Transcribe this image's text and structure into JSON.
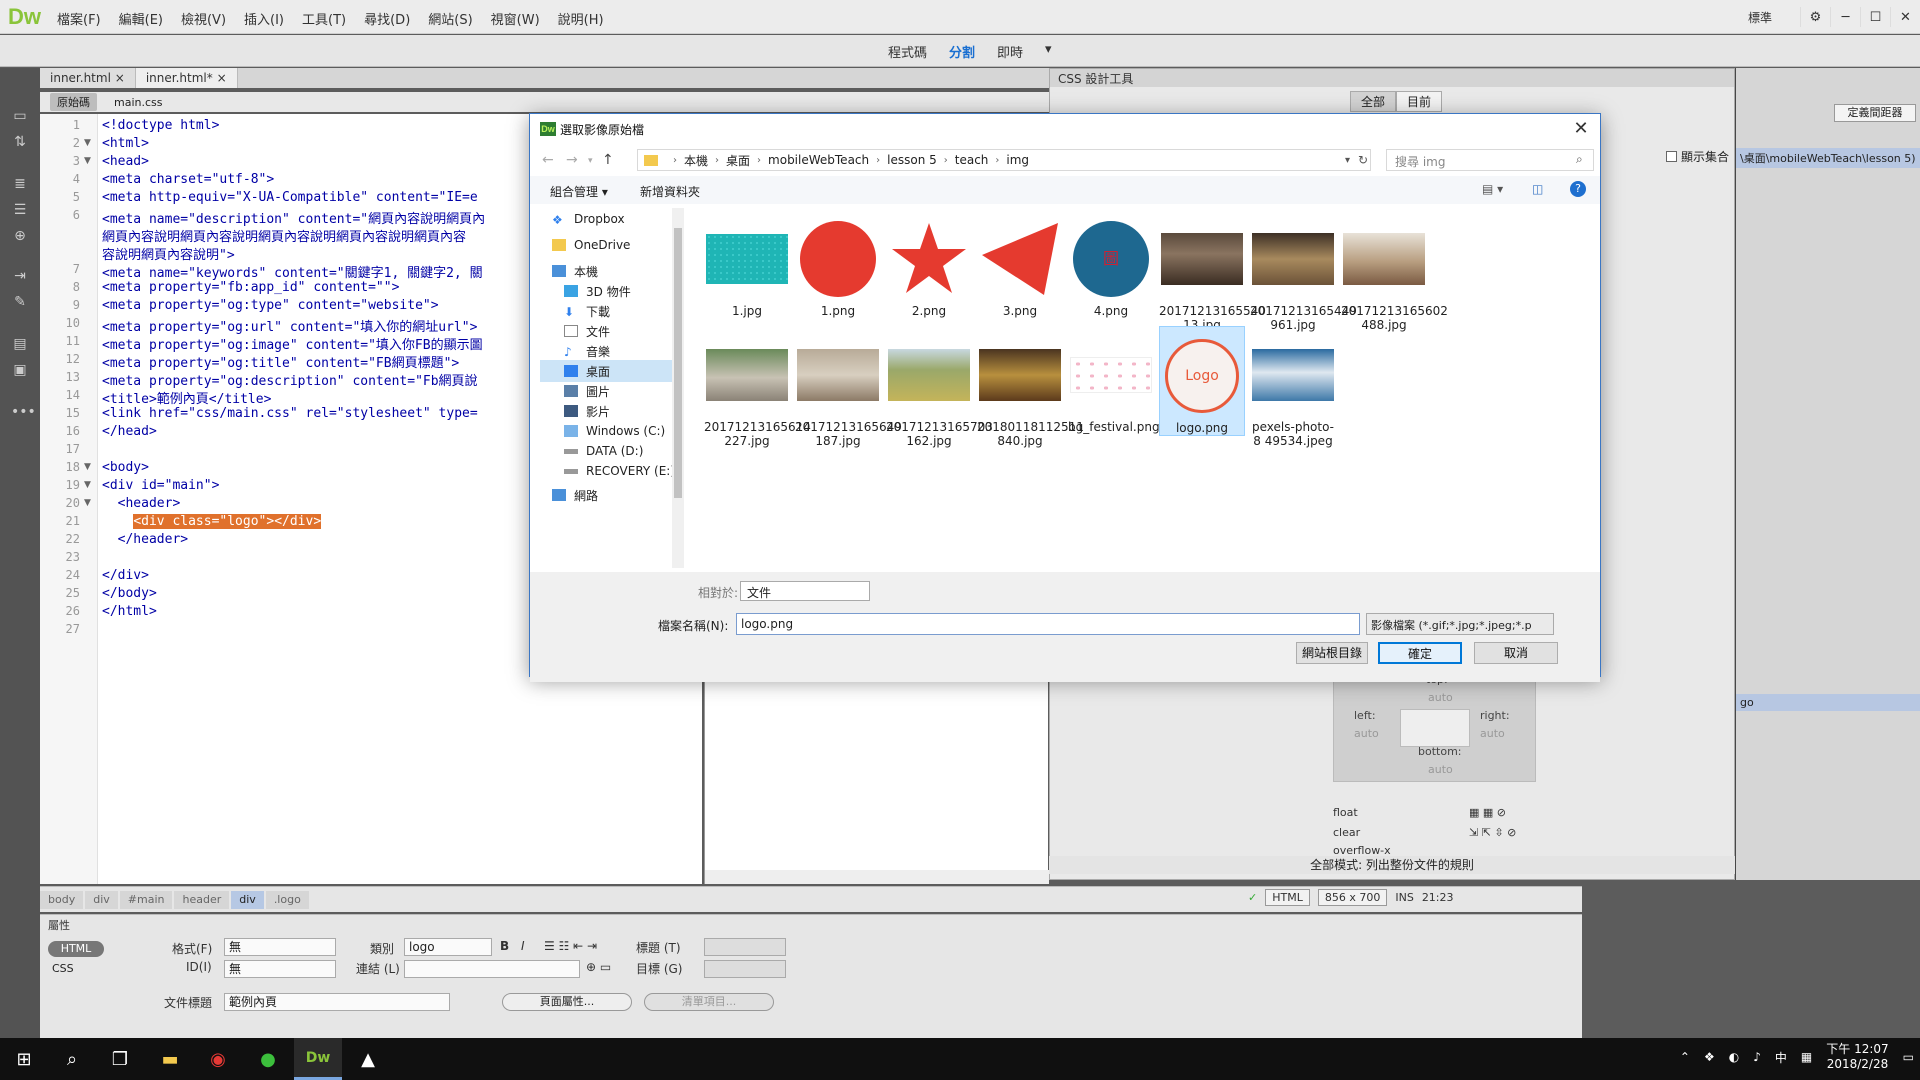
{
  "app": {
    "logo": "Dw",
    "menus": [
      "檔案(F)",
      "編輯(E)",
      "檢視(V)",
      "插入(I)",
      "工具(T)",
      "尋找(D)",
      "網站(S)",
      "視窗(W)",
      "說明(H)"
    ],
    "layout_label": "標準"
  },
  "views": {
    "code": "程式碼",
    "split": "分割",
    "live": "即時"
  },
  "document_tabs": [
    {
      "label": "inner.html",
      "close": "×"
    },
    {
      "label": "inner.html*",
      "close": "×"
    }
  ],
  "sub_tabs": [
    "原始碼",
    "main.css"
  ],
  "code_lines": [
    {
      "n": "1",
      "text": "<!doctype html>"
    },
    {
      "n": "2",
      "text": "<html>"
    },
    {
      "n": "3",
      "text": "<head>"
    },
    {
      "n": "4",
      "text": "<meta charset=\"utf-8\">"
    },
    {
      "n": "5",
      "text": "<meta http-equiv=\"X-UA-Compatible\" content=\"IE=e"
    },
    {
      "n": "6",
      "text": "<meta name=\"description\" content=\"網頁內容說明網頁內"
    },
    {
      "n": "",
      "text": "網頁內容說明網頁內容說明網頁內容說明網頁內容說明網頁內容"
    },
    {
      "n": "",
      "text": "容說明網頁內容說明\">"
    },
    {
      "n": "7",
      "text": "<meta name=\"keywords\" content=\"關鍵字1, 關鍵字2, 關"
    },
    {
      "n": "8",
      "text": "<meta property=\"fb:app_id\" content=\"\">"
    },
    {
      "n": "9",
      "text": "<meta property=\"og:type\" content=\"website\">"
    },
    {
      "n": "10",
      "text": "<meta property=\"og:url\" content=\"填入你的網址url\">"
    },
    {
      "n": "11",
      "text": "<meta property=\"og:image\" content=\"填入你FB的顯示圖"
    },
    {
      "n": "12",
      "text": "<meta property=\"og:title\" content=\"FB網頁標題\">"
    },
    {
      "n": "13",
      "text": "<meta property=\"og:description\" content=\"Fb網頁說"
    },
    {
      "n": "14",
      "text": "<title>範例內頁</title>"
    },
    {
      "n": "15",
      "text": "<link href=\"css/main.css\" rel=\"stylesheet\" type="
    },
    {
      "n": "16",
      "text": "</head>"
    },
    {
      "n": "17",
      "text": ""
    },
    {
      "n": "18",
      "text": "<body>"
    },
    {
      "n": "19",
      "text": "<div id=\"main\">"
    },
    {
      "n": "20",
      "text": "  <header>"
    },
    {
      "n": "21",
      "text": "    <div class=\"logo\"></div>"
    },
    {
      "n": "22",
      "text": "  </header>"
    },
    {
      "n": "23",
      "text": ""
    },
    {
      "n": "24",
      "text": "</div>"
    },
    {
      "n": "25",
      "text": "</body>"
    },
    {
      "n": "26",
      "text": "</html>"
    },
    {
      "n": "27",
      "text": ""
    }
  ],
  "css_designer": {
    "title": "CSS 設計工具",
    "tabs": [
      "全部",
      "目前"
    ],
    "define_btn": "定義間距器",
    "show_set": "顯示集合",
    "path_text": "\\桌面\\mobileWebTeach\\lesson 5)",
    "selector_short": "go",
    "all_mode": "全部模式: 列出整份文件的規則",
    "box": {
      "top": "top:",
      "top_val": "auto",
      "left": "left:",
      "left_val": "auto",
      "right": "right:",
      "right_val": "auto",
      "bottom": "bottom:",
      "bottom_val": "auto"
    },
    "float": "float",
    "clear": "clear",
    "overflow": "overflow-x"
  },
  "status": {
    "crumbs": [
      "body",
      "div",
      "#main",
      "header",
      "div",
      ".logo"
    ],
    "lang": "HTML",
    "size": "856 x 700",
    "ins": "INS",
    "pos": "21:23"
  },
  "props": {
    "title": "屬性",
    "html_mode": "HTML",
    "css_mode": "CSS",
    "format_label": "格式(F)",
    "format_val": "無",
    "id_label": "ID(I)",
    "id_val": "無",
    "class_label": "類別",
    "class_val": "logo",
    "link_label": "連結 (L)",
    "title_label": "標題 (T)",
    "target_label": "目標 (G)",
    "doc_title_label": "文件標題",
    "doc_title_val": "範例內頁",
    "page_props_btn": "頁面屬性...",
    "list_btn": "清單項目..."
  },
  "dialog": {
    "title": "選取影像原始檔",
    "path": [
      "本機",
      "桌面",
      "mobileWebTeach",
      "lesson 5",
      "teach",
      "img"
    ],
    "search_placeholder": "搜尋 img",
    "organize": "組合管理 ▾",
    "new_folder": "新增資料夾",
    "nav": [
      "Dropbox",
      "OneDrive",
      "本機",
      "3D 物件",
      "下載",
      "文件",
      "音樂",
      "桌面",
      "圖片",
      "影片",
      "Windows (C:)",
      "DATA (D:)",
      "RECOVERY (E:)",
      "網路"
    ],
    "files": [
      {
        "name": "1.jpg",
        "thumb": "teal-rect"
      },
      {
        "name": "1.png",
        "thumb": "red-circle"
      },
      {
        "name": "2.png",
        "thumb": "red-star"
      },
      {
        "name": "3.png",
        "thumb": "red-triangle"
      },
      {
        "name": "4.png",
        "thumb": "blue-circle"
      },
      {
        "name": "20171213165540 13.jpg",
        "thumb": "photo-interior"
      },
      {
        "name": "20171213165449 961.jpg",
        "thumb": "photo-cafe"
      },
      {
        "name": "20171213165602 488.jpg",
        "thumb": "photo-room"
      },
      {
        "name": "20171213165614 227.jpg",
        "thumb": "photo-street"
      },
      {
        "name": "20171213165649 187.jpg",
        "thumb": "photo-cats"
      },
      {
        "name": "20171213165703 162.jpg",
        "thumb": "photo-fields"
      },
      {
        "name": "20180118112511 840.jpg",
        "thumb": "photo-painting"
      },
      {
        "name": "bg_festival.png",
        "thumb": "festival"
      },
      {
        "name": "logo.png",
        "thumb": "logo"
      },
      {
        "name": "pexels-photo-8 49534.jpeg",
        "thumb": "photo-mountain"
      }
    ],
    "logo_text": "Logo",
    "relative_label": "相對於:",
    "relative_val": "文件",
    "filename_label": "檔案名稱(N):",
    "filename_val": "logo.png",
    "filetype": "影像檔案 (*.gif;*.jpg;*.jpeg;*.p",
    "site_root_btn": "網站根目錄",
    "ok_btn": "確定",
    "cancel_btn": "取消"
  },
  "taskbar": {
    "clock_time": "下午 12:07",
    "clock_date": "2018/2/28",
    "ime": "中"
  }
}
